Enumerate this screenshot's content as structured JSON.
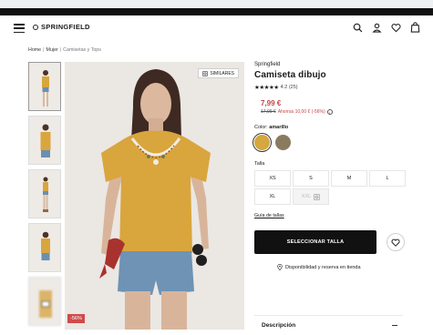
{
  "header": {
    "logo_text": "SPRINGFIELD"
  },
  "breadcrumb": {
    "items": [
      "Home",
      "Mujer",
      "Camisetas y Tops"
    ],
    "separator": "|"
  },
  "gallery": {
    "similar_label": "SIMILARES",
    "discount_tag": "-56%"
  },
  "product": {
    "brand": "Springfield",
    "title": "Camiseta dibujo",
    "stars": "★★★★★",
    "rating": "4.2 (25)",
    "price": "7,99 €",
    "old_price": "17,99 €",
    "savings": "Ahorras 10,00 € (-56%)",
    "info_symbol": "i"
  },
  "color": {
    "label": "Color:",
    "selected": "amarillo",
    "swatches": [
      {
        "name": "amarillo",
        "hex": "#d6a73f"
      },
      {
        "name": "marron",
        "hex": "#8a7b60"
      }
    ]
  },
  "size": {
    "label": "Talla",
    "options": [
      "XS",
      "S",
      "M",
      "L",
      "XL",
      "XXL"
    ],
    "guide": "Guía de tallas"
  },
  "actions": {
    "select_size": "SELECCIONAR TALLA",
    "availability": "Disponibilidad y reserva en tienda"
  },
  "description": {
    "title": "Descripción"
  },
  "colors": {
    "accent_price": "#c54545",
    "cta_bg": "#111111",
    "shirt": "#d9a53d"
  }
}
